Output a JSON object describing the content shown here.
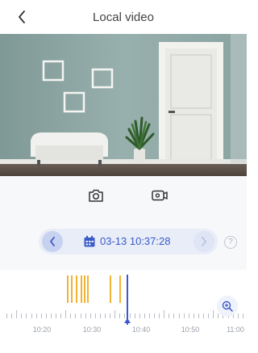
{
  "header": {
    "title": "Local video"
  },
  "controls": {
    "snapshot_icon": "camera-icon",
    "record_icon": "video-record-icon"
  },
  "playback": {
    "date_time": "03-13 10:37:28",
    "prev_icon": "chevron-left-icon",
    "next_icon": "chevron-right-icon",
    "help_label": "?"
  },
  "timeline": {
    "labels": [
      "10:20",
      "10:30",
      "10:40",
      "10:50",
      "11:00"
    ],
    "recording_color": "#f2b333",
    "cursor_color": "#3e57c9",
    "current_time": "10:37:28"
  },
  "colors": {
    "accent": "#3e57c9",
    "pill_bg": "#e8edf8"
  }
}
